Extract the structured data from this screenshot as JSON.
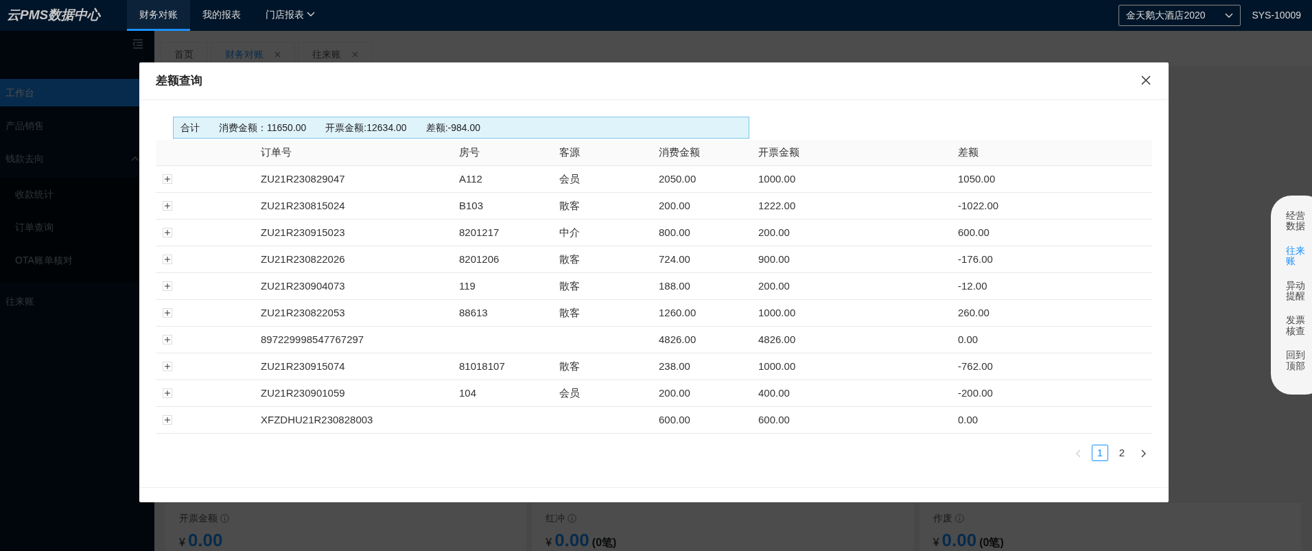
{
  "header": {
    "logo": "云PMS数据中心",
    "nav": [
      {
        "label": "财务对账",
        "selected": true,
        "dropdown": false
      },
      {
        "label": "我的报表",
        "selected": false,
        "dropdown": false
      },
      {
        "label": "门店报表",
        "selected": false,
        "dropdown": true
      }
    ],
    "hotel_select": {
      "value": "金天鹅大酒店2020"
    },
    "user": "SYS-10009"
  },
  "sidebar": {
    "items": [
      {
        "label": "工作台",
        "selected": true
      },
      {
        "label": "产品销售",
        "selected": false
      },
      {
        "label": "钱款去向",
        "selected": false,
        "expanded": true,
        "children": [
          {
            "label": "收款统计",
            "selected": false
          },
          {
            "label": "订单查询",
            "selected": false
          },
          {
            "label": "OTA账单核对",
            "selected": false
          }
        ]
      },
      {
        "label": "往来账",
        "selected": false
      }
    ]
  },
  "tabs": [
    {
      "label": "首页",
      "selected": false,
      "closable": false
    },
    {
      "label": "财务对账",
      "selected": true,
      "closable": true
    },
    {
      "label": "往来账",
      "selected": false,
      "closable": true
    }
  ],
  "summary_cards": [
    {
      "label": "开票金额",
      "currency": "¥",
      "amount": "0.00"
    },
    {
      "label": "红冲",
      "currency": "¥",
      "amount": "0.00",
      "count": "(0笔)"
    },
    {
      "label": "作废",
      "currency": "¥",
      "amount": "0.00",
      "count": "(0笔)"
    }
  ],
  "float_panel": {
    "items": [
      {
        "label": "经营数据",
        "selected": false
      },
      {
        "label": "往来账",
        "selected": true
      },
      {
        "label": "异动提醒",
        "selected": false
      },
      {
        "label": "发票核查",
        "selected": false
      },
      {
        "label": "回到顶部",
        "selected": false
      }
    ]
  },
  "modal": {
    "title": "差额查询",
    "summary": {
      "label": "合计",
      "parts": [
        "消费金额：11650.00",
        "开票金额:12634.00",
        "差额:-984.00"
      ]
    },
    "table": {
      "columns": [
        "订单号",
        "房号",
        "客源",
        "消费金额",
        "开票金额",
        "差额"
      ],
      "rows": [
        {
          "expanded": false,
          "order_no": "ZU21R230829047",
          "room": "A112",
          "source": "会员",
          "consumption": "2050.00",
          "invoiced": "1000.00",
          "difference": "1050.00"
        },
        {
          "expanded": false,
          "order_no": "ZU21R230815024",
          "room": "B103",
          "source": "散客",
          "consumption": "200.00",
          "invoiced": "1222.00",
          "difference": "-1022.00"
        },
        {
          "expanded": false,
          "order_no": "ZU21R230915023",
          "room": "8201217",
          "source": "中介",
          "consumption": "800.00",
          "invoiced": "200.00",
          "difference": "600.00"
        },
        {
          "expanded": false,
          "order_no": "ZU21R230822026",
          "room": "8201206",
          "source": "散客",
          "consumption": "724.00",
          "invoiced": "900.00",
          "difference": "-176.00"
        },
        {
          "expanded": false,
          "order_no": "ZU21R230904073",
          "room": "119",
          "source": "散客",
          "consumption": "188.00",
          "invoiced": "200.00",
          "difference": "-12.00"
        },
        {
          "expanded": false,
          "order_no": "ZU21R230822053",
          "room": "88613",
          "source": "散客",
          "consumption": "1260.00",
          "invoiced": "1000.00",
          "difference": "260.00"
        },
        {
          "expanded": false,
          "order_no": "897229998547767297",
          "consumption": "4826.00",
          "invoiced": "4826.00",
          "difference": "0.00"
        },
        {
          "expanded": false,
          "order_no": "ZU21R230915074",
          "room": "81018107",
          "source": "散客",
          "consumption": "238.00",
          "invoiced": "1000.00",
          "difference": "-762.00"
        },
        {
          "expanded": false,
          "order_no": "ZU21R230901059",
          "room": "104",
          "source": "会员",
          "consumption": "200.00",
          "invoiced": "400.00",
          "difference": "-200.00"
        },
        {
          "expanded": false,
          "order_no": "XFZDHU21R230828003",
          "consumption": "600.00",
          "invoiced": "600.00",
          "difference": "0.00"
        }
      ]
    },
    "pagination": {
      "prev_disabled": true,
      "next_disabled": false,
      "pages": [
        {
          "label": "1",
          "selected": true
        },
        {
          "label": "2",
          "selected": false
        }
      ]
    }
  }
}
